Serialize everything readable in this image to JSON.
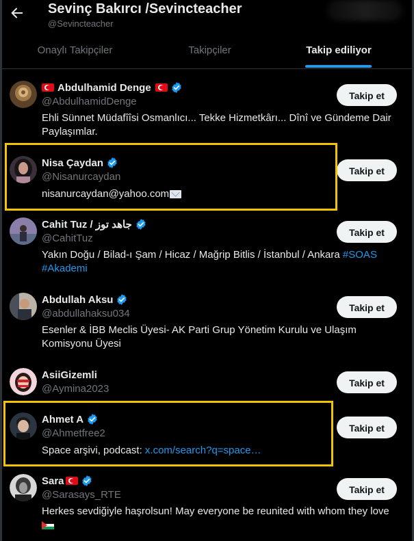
{
  "header": {
    "title": "Sevinç Bakırcı /Sevincteacher",
    "handle": "@Sevincteacher"
  },
  "tabs": [
    {
      "label": "Onaylı Takipçiler",
      "active": false
    },
    {
      "label": "Takipçiler",
      "active": false
    },
    {
      "label": "Takip ediliyor",
      "active": true
    }
  ],
  "follow_label": "Takip et",
  "users": [
    {
      "name": "Abdulhamid Denge",
      "handle": "@AbdulhamidDenge",
      "verified": true,
      "bio": "Ehli Sünnet Müdafîîsi Osmanlıcı... Tekke Hizmetkârı... Dînî ve Gündeme Dair Paylaşımlar."
    },
    {
      "name": "Nisa Çaydan",
      "handle": "@Nisanurcaydan",
      "verified": true,
      "bio": "nisanurcaydan@yahoo.com"
    },
    {
      "name": "Cahit Tuz / جاهد توز",
      "handle": "@CahitTuz",
      "verified": true,
      "bio": "Yakın Doğu / Bilad-ı Şam / Hicaz / Mağrip Bitlis / İstanbul / Ankara ",
      "bio_links": [
        "#SOAS",
        "#Akademi"
      ]
    },
    {
      "name": "Abdullah Aksu",
      "handle": "@abdullahaksu034",
      "verified": true,
      "bio": "Esenler & İBB Meclis Üyesi- AK Parti Grup Yönetim Kurulu ve Ulaşım Komisyonu Üyesi"
    },
    {
      "name": "AsiiGizemli",
      "handle": "@Aymina2023",
      "verified": false,
      "bio": ""
    },
    {
      "name": "Ahmet A",
      "handle": "@Ahmetfree2",
      "verified": true,
      "bio": "Space arşivi, podcast: ",
      "bio_link": "x.com/search?q=space…"
    },
    {
      "name": "Sara",
      "handle": "@Sarasays_RTE",
      "verified": true,
      "bio": "Herkes sevdiğiyle haşrolsun! May everyone be reunited with whom they love"
    }
  ],
  "colors": {
    "accent": "#1d9bf0",
    "highlight": "#f5c400",
    "background": "#000000",
    "muted": "#71767b"
  },
  "icons": [
    "back-arrow-icon",
    "verified-badge-icon",
    "turkey-flag-icon",
    "envelope-icon",
    "palestine-flag-icon"
  ]
}
